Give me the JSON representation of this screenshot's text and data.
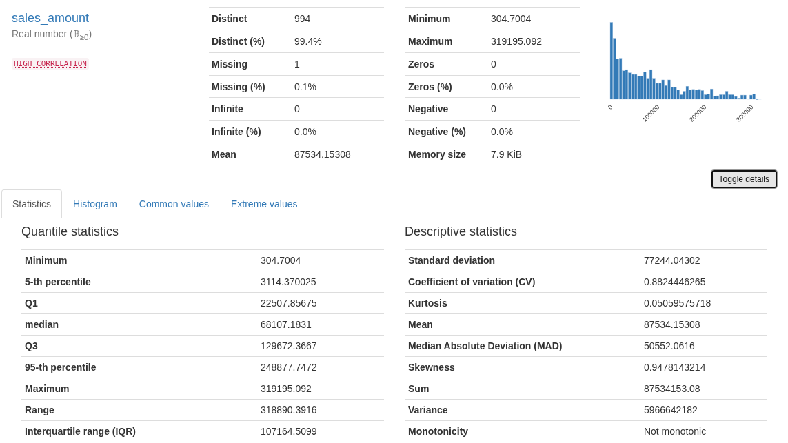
{
  "variable": {
    "name": "sales_amount",
    "type": "Real number (ℝ$_{≥0}$)",
    "alert": "HIGH CORRELATION"
  },
  "overview_left": [
    {
      "label": "Distinct",
      "value": "994"
    },
    {
      "label": "Distinct (%)",
      "value": "99.4%"
    },
    {
      "label": "Missing",
      "value": "1"
    },
    {
      "label": "Missing (%)",
      "value": "0.1%"
    },
    {
      "label": "Infinite",
      "value": "0"
    },
    {
      "label": "Infinite (%)",
      "value": "0.0%"
    },
    {
      "label": "Mean",
      "value": "87534.15308"
    }
  ],
  "overview_right": [
    {
      "label": "Minimum",
      "value": "304.7004"
    },
    {
      "label": "Maximum",
      "value": "319195.092"
    },
    {
      "label": "Zeros",
      "value": "0"
    },
    {
      "label": "Zeros (%)",
      "value": "0.0%"
    },
    {
      "label": "Negative",
      "value": "0"
    },
    {
      "label": "Negative (%)",
      "value": "0.0%"
    },
    {
      "label": "Memory size",
      "value": "7.9 KiB"
    }
  ],
  "mini_histogram": {
    "x_tick_labels": [
      "0",
      "100000",
      "200000",
      "300000"
    ]
  },
  "toggle_button": "Toggle details",
  "tabs": [
    {
      "label": "Statistics",
      "selected": true
    },
    {
      "label": "Histogram",
      "selected": false
    },
    {
      "label": "Common values",
      "selected": false
    },
    {
      "label": "Extreme values",
      "selected": false
    }
  ],
  "sections": [
    {
      "title": "Quantile statistics",
      "rows": [
        {
          "label": "Minimum",
          "value": "304.7004"
        },
        {
          "label": "5-th percentile",
          "value": "3114.370025"
        },
        {
          "label": "Q1",
          "value": "22507.85675"
        },
        {
          "label": "median",
          "value": "68107.1831"
        },
        {
          "label": "Q3",
          "value": "129672.3667"
        },
        {
          "label": "95-th percentile",
          "value": "248877.7472"
        },
        {
          "label": "Maximum",
          "value": "319195.092"
        },
        {
          "label": "Range",
          "value": "318890.3916"
        },
        {
          "label": "Interquartile range (IQR)",
          "value": "107164.5099"
        }
      ]
    },
    {
      "title": "Descriptive statistics",
      "rows": [
        {
          "label": "Standard deviation",
          "value": "77244.04302"
        },
        {
          "label": "Coefficient of variation (CV)",
          "value": "0.8824446265"
        },
        {
          "label": "Kurtosis",
          "value": "0.05059575718"
        },
        {
          "label": "Mean",
          "value": "87534.15308"
        },
        {
          "label": "Median Absolute Deviation (MAD)",
          "value": "50552.0616"
        },
        {
          "label": "Skewness",
          "value": "0.9478143214"
        },
        {
          "label": "Sum",
          "value": "87534153.08"
        },
        {
          "label": "Variance",
          "value": "5966642182"
        },
        {
          "label": "Monotonicity",
          "value": "Not monotonic"
        }
      ]
    }
  ]
}
